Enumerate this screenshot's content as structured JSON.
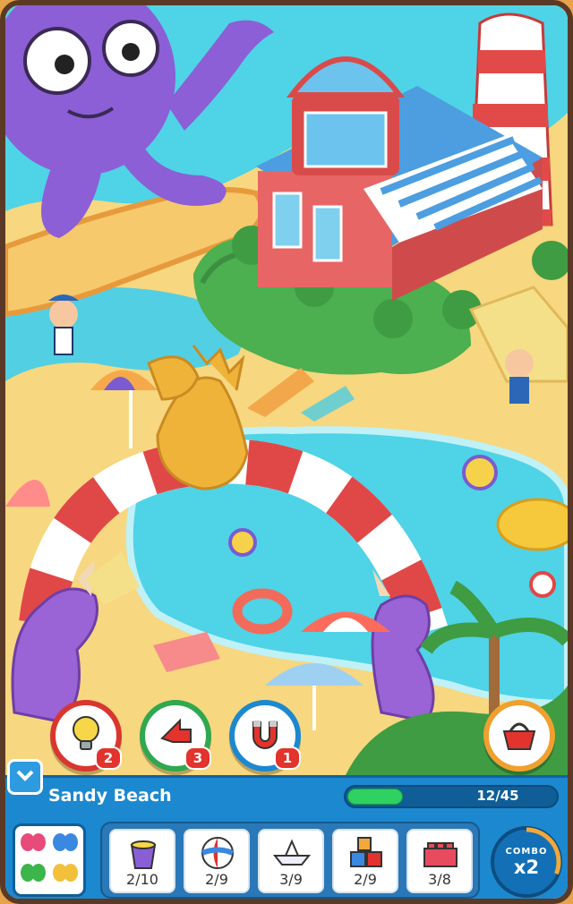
{
  "level": {
    "name": "Sandy Beach",
    "progress_text": "12/45",
    "found": 12,
    "total": 45
  },
  "powerups": [
    {
      "name": "hint",
      "icon": "lightbulb-icon",
      "count": "2",
      "border": "#d9362f"
    },
    {
      "name": "arrow",
      "icon": "arrow-up-icon",
      "count": "3",
      "border": "#2fa84f"
    },
    {
      "name": "magnet",
      "icon": "magnet-icon",
      "count": "1",
      "border": "#1c88cf"
    }
  ],
  "basket": {
    "icon": "basket-icon"
  },
  "items": [
    {
      "icon": "bucket-icon",
      "count": "2/10"
    },
    {
      "icon": "beach-ball-icon",
      "count": "2/9"
    },
    {
      "icon": "paper-boat-icon",
      "count": "3/9"
    },
    {
      "icon": "toy-blocks-icon",
      "count": "2/9"
    },
    {
      "icon": "lego-brick-icon",
      "count": "3/8"
    }
  ],
  "combo": {
    "label": "COMBO",
    "value": "x2"
  },
  "colors": {
    "panel": "#1c88cf",
    "progress": "#2fd160",
    "sea": "#4fd3e6",
    "sand": "#f7d77f"
  }
}
